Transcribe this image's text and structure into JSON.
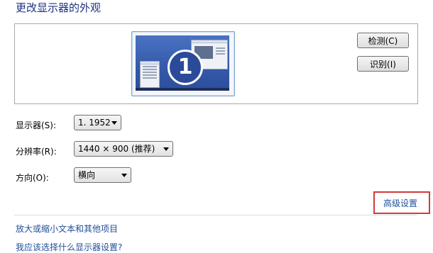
{
  "page": {
    "title": "更改显示器的外观"
  },
  "preview": {
    "monitor_number": "1"
  },
  "buttons": {
    "detect": "检测(C)",
    "identify": "识别(I)"
  },
  "display": {
    "label": "显示器(S):",
    "value": "1. 1952"
  },
  "resolution": {
    "label": "分辨率(R):",
    "value": "1440 × 900 (推荐)"
  },
  "orientation": {
    "label": "方向(O):",
    "value": "横向"
  },
  "links": {
    "advanced": "高级设置",
    "text_size": "放大或缩小文本和其他项目",
    "which_settings": "我应该选择什么显示器设置?"
  },
  "colors": {
    "highlight_box": "#d23b3b",
    "link": "#1f4e9a",
    "title": "#1e3287"
  }
}
